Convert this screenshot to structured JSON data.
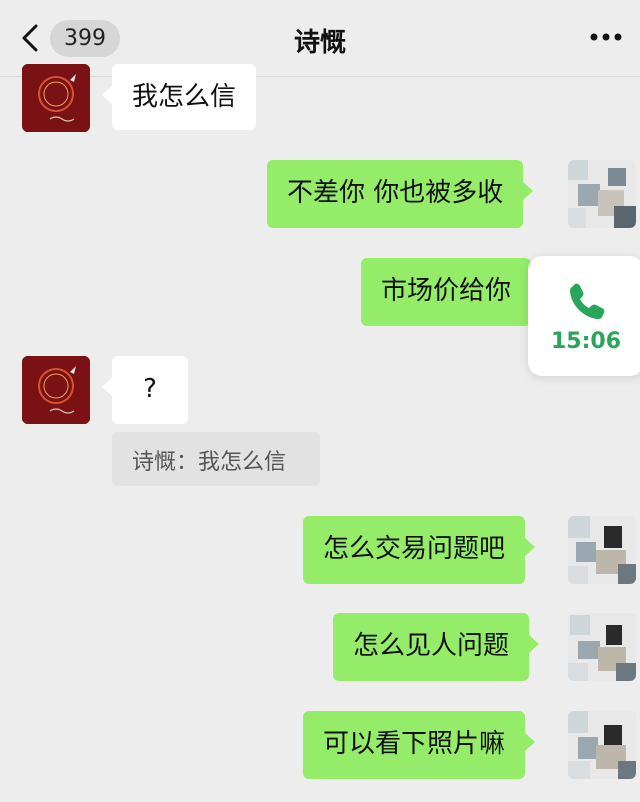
{
  "header": {
    "back_count": "399",
    "title": "诗慨"
  },
  "messages": [
    {
      "side": "left",
      "text": "我怎么信"
    },
    {
      "side": "right",
      "text": "不差你 你也被多收"
    },
    {
      "side": "right",
      "text": "市场价给你"
    },
    {
      "side": "left",
      "text": "?"
    },
    {
      "side": "right",
      "text": "怎么交易问题吧"
    },
    {
      "side": "right",
      "text": "怎么见人问题"
    },
    {
      "side": "right",
      "text": "可以看下照片嘛"
    }
  ],
  "quote": {
    "text": "诗慨：我怎么信"
  },
  "call_overlay": {
    "time": "15:06",
    "icon": "phone-icon"
  },
  "colors": {
    "sent_bubble": "#95ec69",
    "received_bubble": "#ffffff",
    "background": "#ededed",
    "call_green": "#2aa65a"
  }
}
